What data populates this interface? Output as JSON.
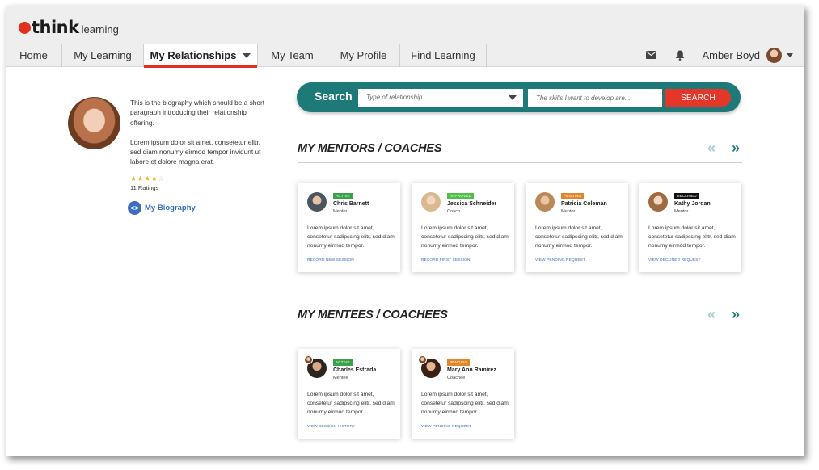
{
  "logo": {
    "brand": "think",
    "suffix": "learning"
  },
  "nav": {
    "items": [
      {
        "label": "Home"
      },
      {
        "label": "My Learning"
      },
      {
        "label": "My Relationships"
      },
      {
        "label": "My Team"
      },
      {
        "label": "My Profile"
      },
      {
        "label": "Find Learning"
      }
    ],
    "active_index": 2
  },
  "header": {
    "user_name": "Amber Boyd",
    "icons": [
      "mail-icon",
      "bell-icon"
    ]
  },
  "profile": {
    "bio_para1": "This is the biography which should be a short paragraph introducing their relationship offering.",
    "bio_para2": "Lorem ipsum dolor sit amet, consetetur elitr, sed diam nonumy eirmod tempor invidunt ut labore et dolore magna erat.",
    "rating": 4,
    "rating_max": 5,
    "ratings_count": "11 Ratings",
    "bio_link": "My Biography"
  },
  "search": {
    "title": "Search",
    "relationship_placeholder": "Type of relationship",
    "skills_placeholder": "The skills I want to develop are...",
    "button": "SEARCH"
  },
  "mentors": {
    "title": "MY MENTORS / COACHES",
    "cards": [
      {
        "status": "ACTIVE",
        "status_type": "active",
        "name": "Chris Barnett",
        "role": "Mentor",
        "text": "Lorem ipsum dolor sit amet, consetetur sadipscing elitr, sed diam nonumy eirmod tempor.",
        "link": "RECORD NEW SESSION"
      },
      {
        "status": "APPROVED",
        "status_type": "approved",
        "name": "Jessica Schneider",
        "role": "Coach",
        "text": "Lorem ipsum dolor sit amet, consetetur sadipscing elitr, sed diam nonumy eirmod tempor.",
        "link": "RECORD FIRST SESSION"
      },
      {
        "status": "PENDING",
        "status_type": "pending",
        "name": "Patricia Coleman",
        "role": "Mentor",
        "text": "Lorem ipsum dolor sit amet, consetetur sadipscing elitr, sed diam nonumy eirmod tempor.",
        "link": "VIEW PENDING REQUEST"
      },
      {
        "status": "DECLINED",
        "status_type": "declined",
        "name": "Kathy Jordan",
        "role": "Mentor",
        "text": "Lorem ipsum dolor sit amet, consetetur sadipscing elitr, sed diam nonumy eirmod tempor.",
        "link": "VIEW DECLINED REQUEST"
      }
    ]
  },
  "mentees": {
    "title": "MY MENTEES / COACHEES",
    "cards": [
      {
        "status": "ACTIVE",
        "status_type": "active",
        "name": "Charles Estrada",
        "role": "Mentee",
        "text": "Lorem ipsum dolor sit amet, consetetur sadipscing elitr, sed diam nonumy eirmod tempor.",
        "link": "VIEW SESSION HISTORY"
      },
      {
        "status": "PENDING",
        "status_type": "pending",
        "name": "Mary Ann Ramirez",
        "role": "Coachee",
        "text": "Lorem ipsum dolor sit amet, consetetur sadipscing elitr, sed diam nonumy eirmod tempor.",
        "link": "VIEW PENDING REQUEST"
      }
    ]
  },
  "carousel": {
    "prev": "«",
    "next": "»"
  },
  "colors": {
    "brand_red": "#e0301e",
    "teal": "#1d7a79",
    "search_red": "#e5362a",
    "link_blue": "#3a6bbb"
  }
}
